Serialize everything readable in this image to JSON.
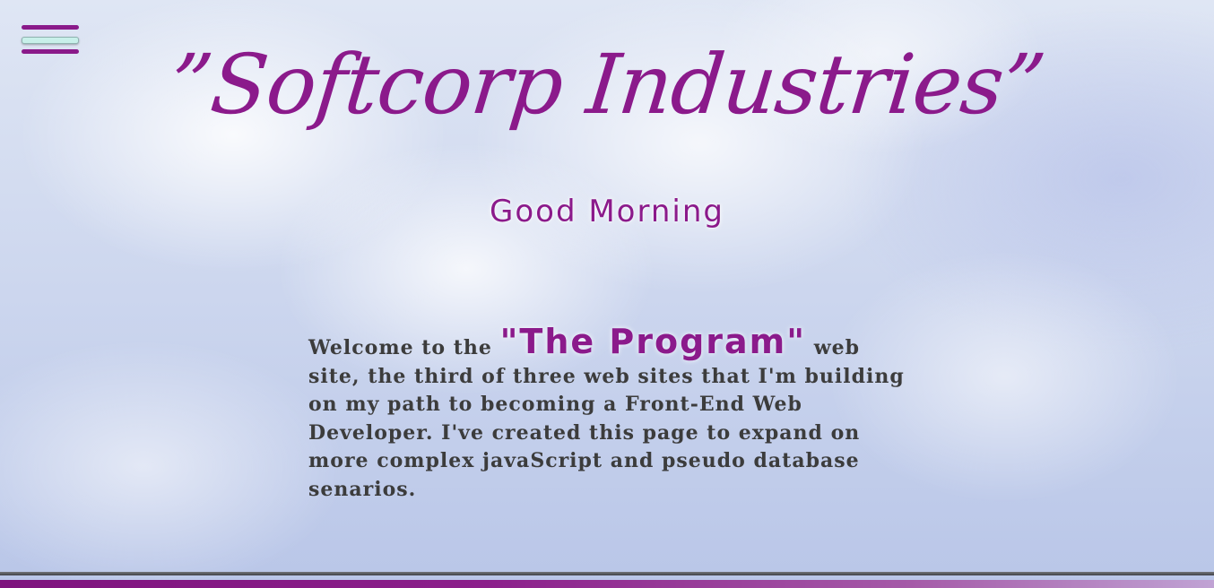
{
  "nav": {
    "menu_icon": "hamburger-menu-icon"
  },
  "header": {
    "title": "”Softcorp Industries”",
    "greeting": "Good Morning"
  },
  "intro": {
    "prefix": "Welcome to the ",
    "program_name": "\"The Program\"",
    "suffix": " web site, the third of three web sites that I'm building on my path to becoming a Front-End Web Developer. I've created this page to expand on more complex javaScript and pseudo database senarios."
  },
  "colors": {
    "brand": "#8b1a8b",
    "body_text": "#3c3c3c",
    "menu_accent": "#c8f0ea"
  }
}
